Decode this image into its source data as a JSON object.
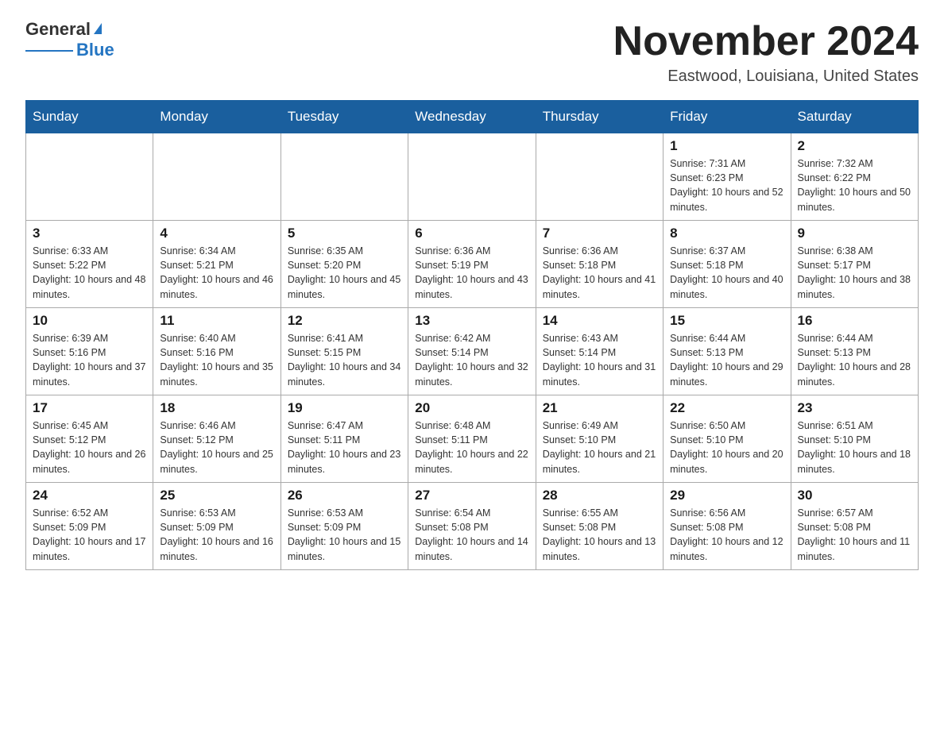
{
  "header": {
    "logo_general": "General",
    "logo_blue": "Blue",
    "month_title": "November 2024",
    "location": "Eastwood, Louisiana, United States"
  },
  "days_of_week": [
    "Sunday",
    "Monday",
    "Tuesday",
    "Wednesday",
    "Thursday",
    "Friday",
    "Saturday"
  ],
  "weeks": [
    [
      {
        "day": "",
        "info": ""
      },
      {
        "day": "",
        "info": ""
      },
      {
        "day": "",
        "info": ""
      },
      {
        "day": "",
        "info": ""
      },
      {
        "day": "",
        "info": ""
      },
      {
        "day": "1",
        "info": "Sunrise: 7:31 AM\nSunset: 6:23 PM\nDaylight: 10 hours and 52 minutes."
      },
      {
        "day": "2",
        "info": "Sunrise: 7:32 AM\nSunset: 6:22 PM\nDaylight: 10 hours and 50 minutes."
      }
    ],
    [
      {
        "day": "3",
        "info": "Sunrise: 6:33 AM\nSunset: 5:22 PM\nDaylight: 10 hours and 48 minutes."
      },
      {
        "day": "4",
        "info": "Sunrise: 6:34 AM\nSunset: 5:21 PM\nDaylight: 10 hours and 46 minutes."
      },
      {
        "day": "5",
        "info": "Sunrise: 6:35 AM\nSunset: 5:20 PM\nDaylight: 10 hours and 45 minutes."
      },
      {
        "day": "6",
        "info": "Sunrise: 6:36 AM\nSunset: 5:19 PM\nDaylight: 10 hours and 43 minutes."
      },
      {
        "day": "7",
        "info": "Sunrise: 6:36 AM\nSunset: 5:18 PM\nDaylight: 10 hours and 41 minutes."
      },
      {
        "day": "8",
        "info": "Sunrise: 6:37 AM\nSunset: 5:18 PM\nDaylight: 10 hours and 40 minutes."
      },
      {
        "day": "9",
        "info": "Sunrise: 6:38 AM\nSunset: 5:17 PM\nDaylight: 10 hours and 38 minutes."
      }
    ],
    [
      {
        "day": "10",
        "info": "Sunrise: 6:39 AM\nSunset: 5:16 PM\nDaylight: 10 hours and 37 minutes."
      },
      {
        "day": "11",
        "info": "Sunrise: 6:40 AM\nSunset: 5:16 PM\nDaylight: 10 hours and 35 minutes."
      },
      {
        "day": "12",
        "info": "Sunrise: 6:41 AM\nSunset: 5:15 PM\nDaylight: 10 hours and 34 minutes."
      },
      {
        "day": "13",
        "info": "Sunrise: 6:42 AM\nSunset: 5:14 PM\nDaylight: 10 hours and 32 minutes."
      },
      {
        "day": "14",
        "info": "Sunrise: 6:43 AM\nSunset: 5:14 PM\nDaylight: 10 hours and 31 minutes."
      },
      {
        "day": "15",
        "info": "Sunrise: 6:44 AM\nSunset: 5:13 PM\nDaylight: 10 hours and 29 minutes."
      },
      {
        "day": "16",
        "info": "Sunrise: 6:44 AM\nSunset: 5:13 PM\nDaylight: 10 hours and 28 minutes."
      }
    ],
    [
      {
        "day": "17",
        "info": "Sunrise: 6:45 AM\nSunset: 5:12 PM\nDaylight: 10 hours and 26 minutes."
      },
      {
        "day": "18",
        "info": "Sunrise: 6:46 AM\nSunset: 5:12 PM\nDaylight: 10 hours and 25 minutes."
      },
      {
        "day": "19",
        "info": "Sunrise: 6:47 AM\nSunset: 5:11 PM\nDaylight: 10 hours and 23 minutes."
      },
      {
        "day": "20",
        "info": "Sunrise: 6:48 AM\nSunset: 5:11 PM\nDaylight: 10 hours and 22 minutes."
      },
      {
        "day": "21",
        "info": "Sunrise: 6:49 AM\nSunset: 5:10 PM\nDaylight: 10 hours and 21 minutes."
      },
      {
        "day": "22",
        "info": "Sunrise: 6:50 AM\nSunset: 5:10 PM\nDaylight: 10 hours and 20 minutes."
      },
      {
        "day": "23",
        "info": "Sunrise: 6:51 AM\nSunset: 5:10 PM\nDaylight: 10 hours and 18 minutes."
      }
    ],
    [
      {
        "day": "24",
        "info": "Sunrise: 6:52 AM\nSunset: 5:09 PM\nDaylight: 10 hours and 17 minutes."
      },
      {
        "day": "25",
        "info": "Sunrise: 6:53 AM\nSunset: 5:09 PM\nDaylight: 10 hours and 16 minutes."
      },
      {
        "day": "26",
        "info": "Sunrise: 6:53 AM\nSunset: 5:09 PM\nDaylight: 10 hours and 15 minutes."
      },
      {
        "day": "27",
        "info": "Sunrise: 6:54 AM\nSunset: 5:08 PM\nDaylight: 10 hours and 14 minutes."
      },
      {
        "day": "28",
        "info": "Sunrise: 6:55 AM\nSunset: 5:08 PM\nDaylight: 10 hours and 13 minutes."
      },
      {
        "day": "29",
        "info": "Sunrise: 6:56 AM\nSunset: 5:08 PM\nDaylight: 10 hours and 12 minutes."
      },
      {
        "day": "30",
        "info": "Sunrise: 6:57 AM\nSunset: 5:08 PM\nDaylight: 10 hours and 11 minutes."
      }
    ]
  ]
}
